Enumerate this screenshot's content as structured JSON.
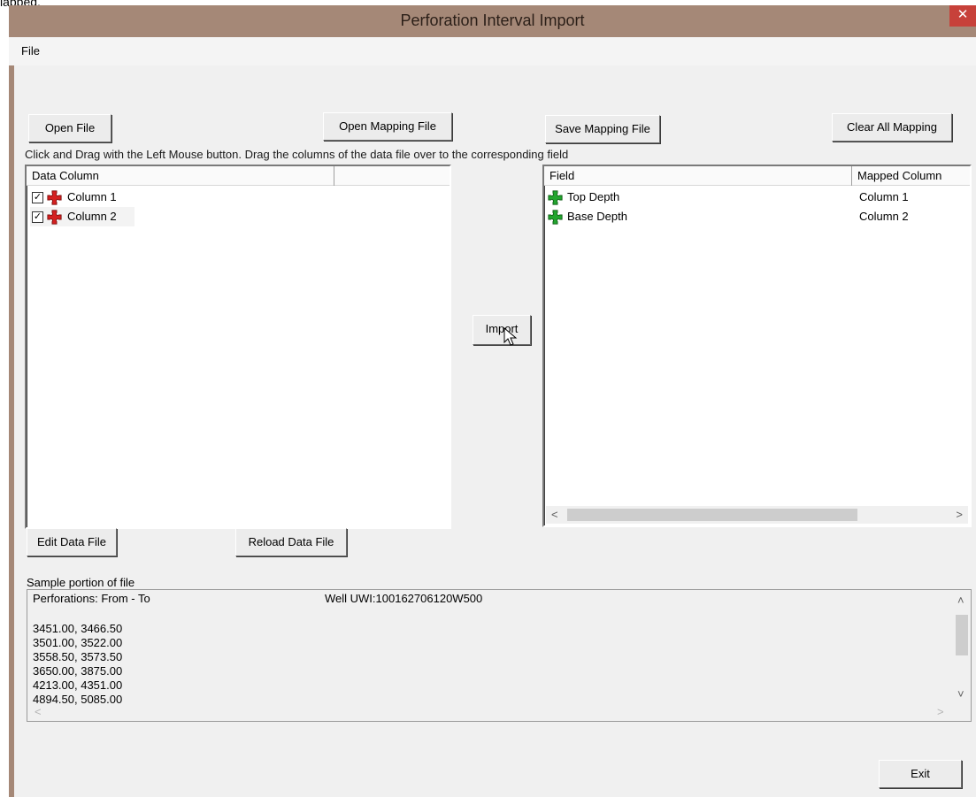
{
  "window": {
    "caption_stub": "lapped.",
    "title": "Perforation Interval Import",
    "close_glyph": "✕"
  },
  "menu": {
    "file": "File"
  },
  "buttons": {
    "open_file": "Open File",
    "open_mapping": "Open Mapping File",
    "save_mapping": "Save Mapping File",
    "clear_mapping": "Clear All Mapping",
    "import": "Import",
    "edit_data": "Edit Data File",
    "reload_data": "Reload Data File",
    "exit": "Exit"
  },
  "hint": "Click and Drag with the Left Mouse button. Drag the columns of the data file over to the corresponding field",
  "data_list": {
    "header": "Data Column",
    "rows": [
      {
        "label": "Column 1",
        "checked": true,
        "icon": "red-puzzle-icon"
      },
      {
        "label": "Column 2",
        "checked": true,
        "icon": "red-puzzle-icon"
      }
    ]
  },
  "field_list": {
    "headers": [
      "Field",
      "Mapped Column"
    ],
    "rows": [
      {
        "field": "Top Depth",
        "mapped": "Column 1",
        "icon": "green-puzzle-icon"
      },
      {
        "field": "Base Depth",
        "mapped": "Column 2",
        "icon": "green-puzzle-icon"
      }
    ]
  },
  "sample": {
    "label": "Sample portion of file",
    "header_left": "Perforations: From - To",
    "header_right": "Well UWI:100162706120W500",
    "lines": [
      "3451.00, 3466.50",
      "3501.00, 3522.00",
      "3558.50, 3573.50",
      "3650.00, 3875.00",
      "4213.00, 4351.00",
      "4894.50, 5085.00"
    ]
  },
  "colors": {
    "title_bar": "#a58877",
    "puzzle_red": "#d42020",
    "puzzle_green": "#22a52e"
  }
}
